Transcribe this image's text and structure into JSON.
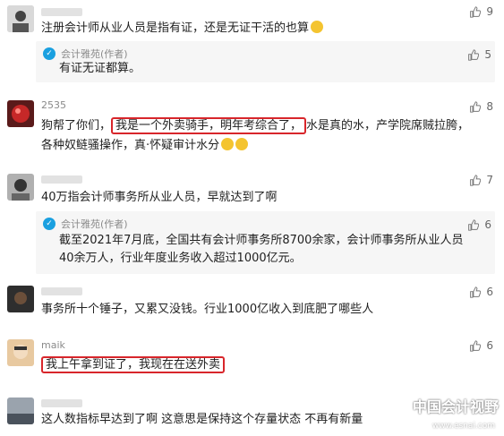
{
  "comments": [
    {
      "username": "",
      "text": "注册会计师从业人员是指有证，还是无证干活的也算",
      "likes": "9",
      "reply": {
        "name": "会计雅苑(作者)",
        "text": "有证无证都算。",
        "likes": "5"
      }
    },
    {
      "username": "2535",
      "text_line1_pre": "狗帮了你们，",
      "text_line1_highlight": "我是一个外卖骑手，明年考综合了，",
      "text_line1_post": "水是真的水，产学院席贼拉胯，",
      "text_line2": "各种奴鲢骚操作，真·怀疑审计水分",
      "likes": "8"
    },
    {
      "username": "",
      "text": "40万指会计师事务所从业人员，早就达到了啊",
      "likes": "7",
      "reply": {
        "name": "会计雅苑(作者)",
        "line1": "截至2021年7月底，全国共有会计师事务所8700余家，会计师事务所从业人员",
        "line2": "40余万人，行业年度业务收入超过1000亿元。",
        "likes": "6"
      }
    },
    {
      "username": "",
      "text": "事务所十个锤子，又累又没钱。行业1000亿收入到底肥了哪些人",
      "likes": "6"
    },
    {
      "username": "maik",
      "text": "我上午拿到证了，我现在在送外卖",
      "likes": "6"
    },
    {
      "username": "",
      "text": "这人数指标早达到了啊   这意思是保持这个存量状态 不再有新量",
      "likes": ""
    }
  ],
  "watermark": {
    "title": "中国会计视野",
    "url": "www.esnai.com"
  },
  "colors": {
    "highlight": "#d8262b",
    "reply_avatar": "#1aa0e0"
  },
  "icons": {
    "like": "thumbs-up-icon"
  }
}
